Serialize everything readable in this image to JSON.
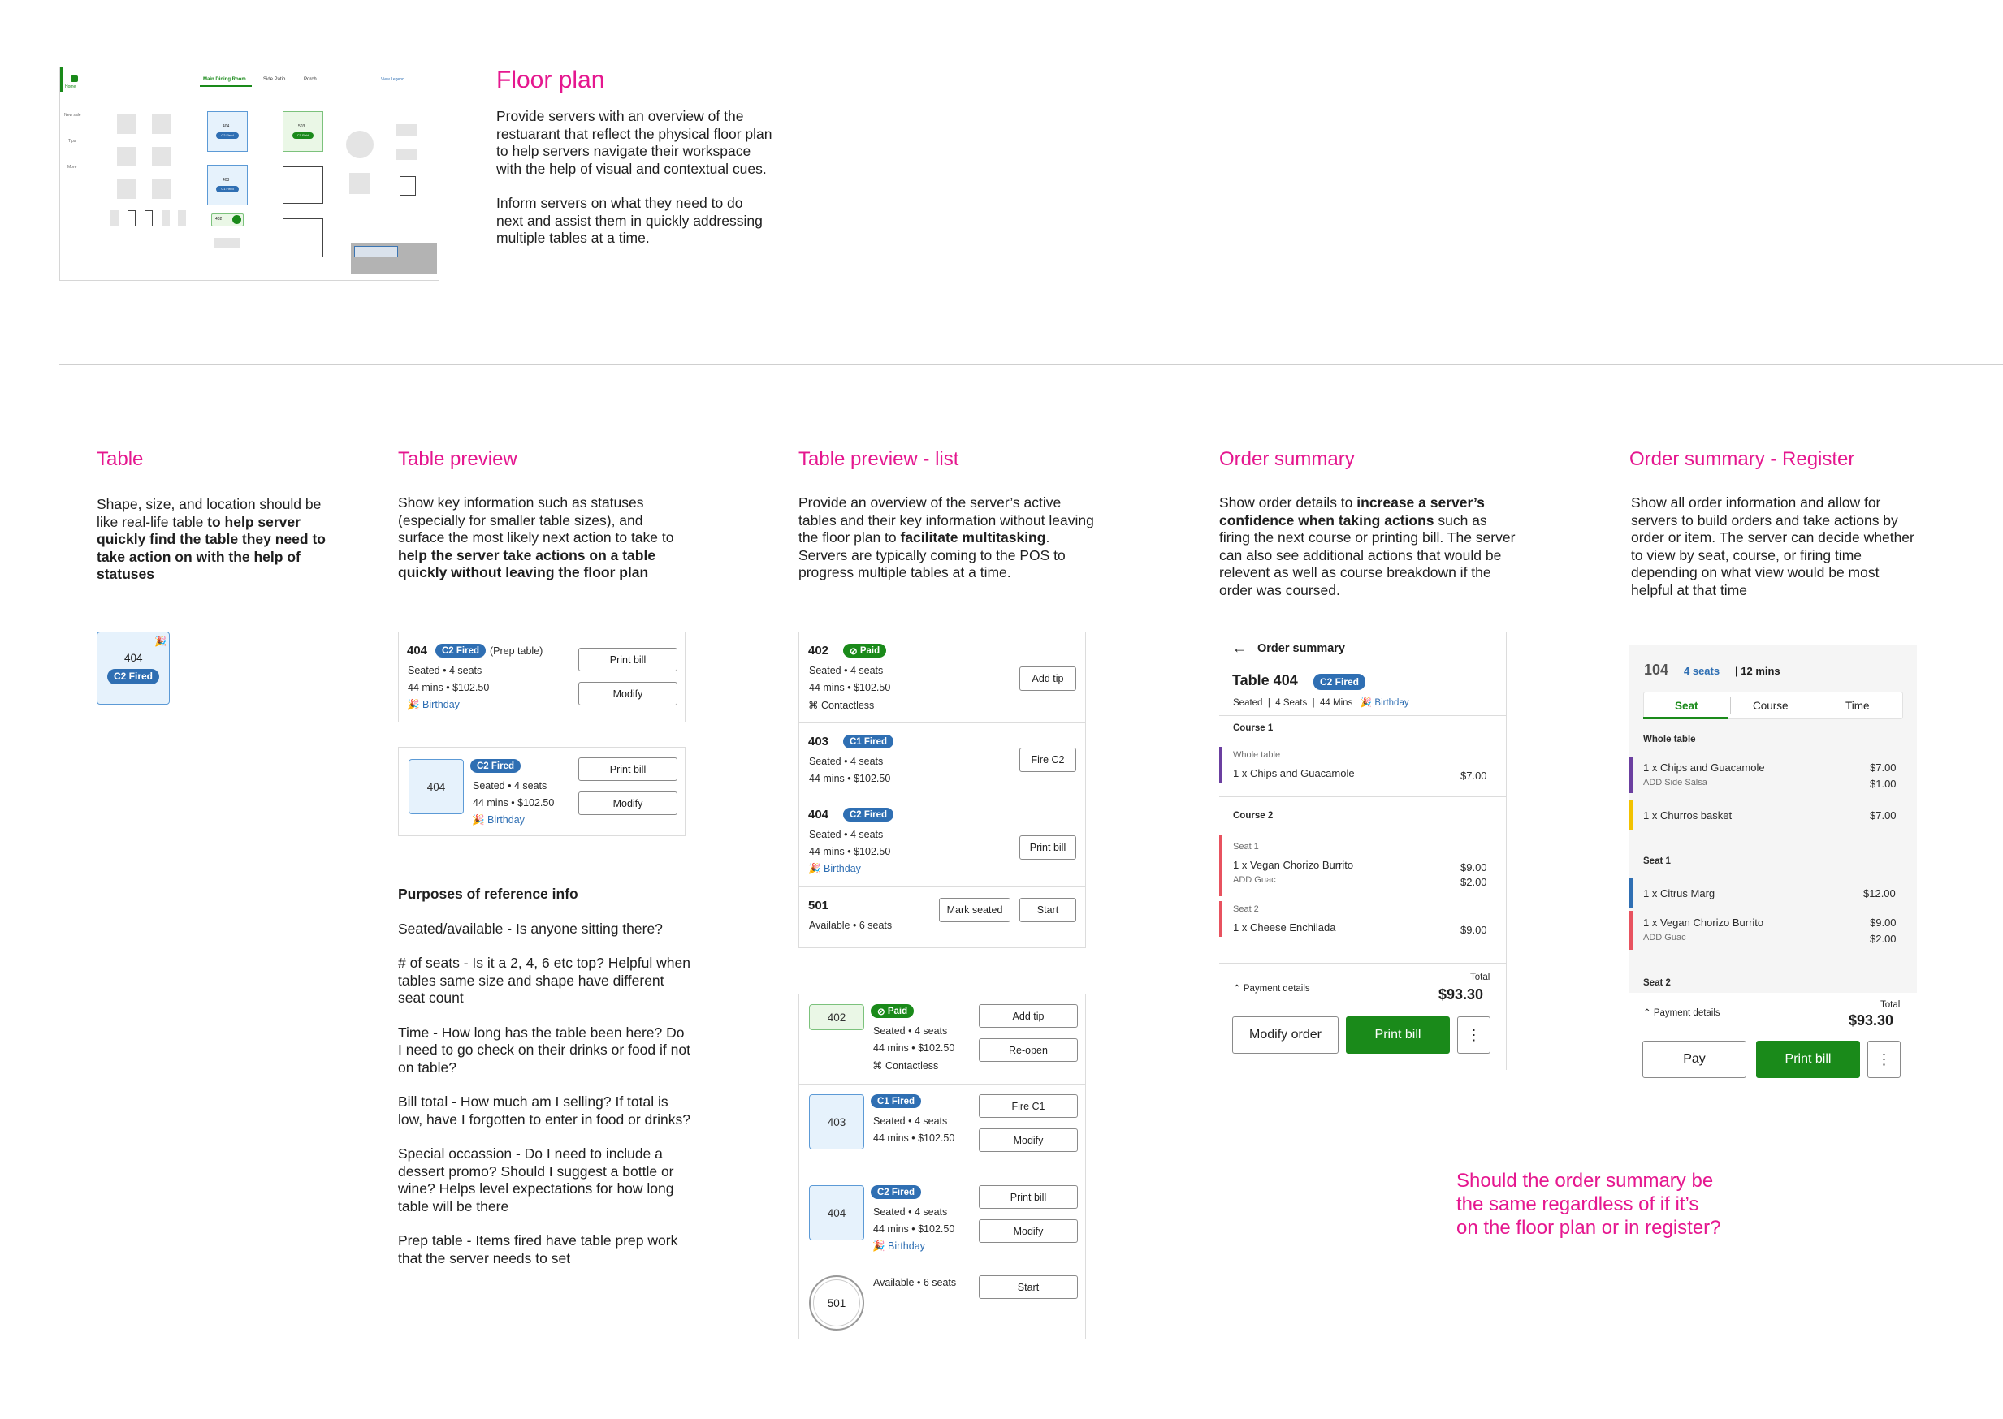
{
  "hero": {
    "title": "Floor plan",
    "p1": "Provide servers with an overview of the restuarant that reflect the physical floor plan to help servers navigate their workspace with the help of visual and contextual cues.",
    "p2": "Inform servers on what they need to do next and assist them in quickly addressing multiple tables at a time."
  },
  "mini": {
    "tab1": "Main Dining Room",
    "tab2": "Side Patio",
    "tab3": "Porch",
    "legend": "View Legend",
    "nav": [
      "Home",
      "New sale",
      "Tips",
      "More"
    ],
    "t404": "404",
    "t404b": "C2 Fired",
    "t403": "403",
    "t403b": "C1 Fired",
    "t503": "503",
    "t503b": "C1 Paid",
    "t402": "402"
  },
  "col1": {
    "title": "Table",
    "intro": "Shape, size, and location should be like real-life table ",
    "intro_b": "to help server quickly find the table they need to take action on with the help of statuses",
    "table_num": "404",
    "badge": "C2 Fired"
  },
  "col2": {
    "title": "Table preview",
    "intro": "Show key information such as statuses (especially for smaller table sizes), and surface the most likely next action to take to ",
    "intro_b": "help the server take actions on a table quickly without leaving the floor plan",
    "c1": {
      "num": "404",
      "badge": "C2 Fired",
      "note": "(Prep table)",
      "l1": "Seated • 4 seats",
      "l2": "44 mins • $102.50",
      "l3": "Birthday",
      "b1": "Print bill",
      "b2": "Modify"
    },
    "c2": {
      "tile": "404",
      "badge": "C2 Fired",
      "l1": "Seated • 4 seats",
      "l2": "44 mins • $102.50",
      "l3": "Birthday",
      "b1": "Print bill",
      "b2": "Modify"
    },
    "ref_title": "Purposes of reference info",
    "ref": [
      "Seated/available - Is anyone sitting there?",
      "# of seats - Is it a 2, 4, 6 etc top? Helpful when tables same size and shape have different seat count",
      "Time - How long has the table been here? Do I need to go check on their drinks or food if not on table?",
      "Bill total - How much am I selling? If total is low, have I forgotten to enter in food or drinks?",
      "Special occassion - Do I need to include a dessert promo? Should I suggest a bottle or wine? Helps level expectations for how long table will be there",
      "Prep table - Items fired have table prep work that the server needs to set"
    ]
  },
  "col3": {
    "title": "Table preview - list",
    "intro1": "Provide an overview of the server’s active tables and their key information without leaving the floor plan to ",
    "intro_b": "facilitate multitasking",
    "intro2": ". Servers are typically coming to the POS to progress multiple tables at a time.",
    "a": [
      {
        "num": "402",
        "badge": "Paid",
        "l1": "Seated • 4 seats",
        "l2": "44 mins • $102.50",
        "l3": "Contactless",
        "b1": "Add tip"
      },
      {
        "num": "403",
        "badge": "C1 Fired",
        "l1": "Seated • 4 seats",
        "l2": "44 mins • $102.50",
        "b1": "Fire C2"
      },
      {
        "num": "404",
        "badge": "C2 Fired",
        "l1": "Seated • 4 seats",
        "l2": "44 mins • $102.50",
        "l3": "Birthday",
        "b1": "Print bill"
      },
      {
        "num": "501",
        "l1": "Available • 6 seats",
        "b0": "Mark seated",
        "b1": "Start"
      }
    ],
    "b": [
      {
        "tile": "402",
        "badge": "Paid",
        "l1": "Seated • 4 seats",
        "l2": "44 mins • $102.50",
        "l3": "Contactless",
        "b1": "Add tip",
        "b2": "Re-open"
      },
      {
        "tile": "403",
        "badge": "C1 Fired",
        "l1": "Seated • 4 seats",
        "l2": "44 mins • $102.50",
        "b1": "Fire C1",
        "b2": "Modify"
      },
      {
        "tile": "404",
        "badge": "C2 Fired",
        "l1": "Seated • 4 seats",
        "l2": "44 mins • $102.50",
        "l3": "Birthday",
        "b1": "Print bill",
        "b2": "Modify"
      },
      {
        "tile": "501",
        "l1": "Available • 6 seats",
        "b1": "Start"
      }
    ]
  },
  "col4": {
    "title": "Order summary",
    "i1": "Show order details to ",
    "ib": "increase a server’s confidence when taking actions",
    "i2": " such as firing the next course or printing bill. The server can also see additional actions that would be relevent as well as course breakdown if the order was coursed.",
    "header": "Order summary",
    "table": "Table 404",
    "badge": "C2 Fired",
    "meta1": "Seated",
    "meta2": "4 Seats",
    "meta3": "44 Mins",
    "meta4": "Birthday",
    "course1": "Course 1",
    "whole": "Whole table",
    "item1": "1 x Chips and Guacamole",
    "p1": "$7.00",
    "course2": "Course 2",
    "seat1": "Seat 1",
    "item2": "1 x Vegan Chorizo Burrito",
    "p2": "$9.00",
    "mod2": "ADD Guac",
    "pm2": "$2.00",
    "seat2": "Seat 2",
    "item3": "1 x Cheese Enchilada",
    "p3": "$9.00",
    "pay": "Payment details",
    "total_l": "Total",
    "total": "$93.30",
    "btn1": "Modify order",
    "btn2": "Print bill"
  },
  "col5": {
    "title": "Order summary - Register",
    "intro": "Show all order information and allow for servers to build orders and take actions by order or item. The server can decide whether to view by seat, course, or firing time depending on what view would be most helpful at that time",
    "table": "104",
    "seats": "4 seats",
    "time": "| 12 mins",
    "tabs": [
      "Seat",
      "Course",
      "Time"
    ],
    "whole": "Whole table",
    "i1": "1 x Chips and Guacamole",
    "p1": "$7.00",
    "m1": "ADD Side Salsa",
    "pm1": "$1.00",
    "i2": "1 x Churros basket",
    "p2": "$7.00",
    "seat1": "Seat 1",
    "i3": "1 x Citrus Marg",
    "p3": "$12.00",
    "i4": "1 x Vegan Chorizo Burrito",
    "p4": "$9.00",
    "m4": "ADD Guac",
    "pm4": "$2.00",
    "seat2": "Seat 2",
    "pay": "Payment details",
    "total_l": "Total",
    "total": "$93.30",
    "btn1": "Pay",
    "btn2": "Print bill"
  },
  "question": "Should the order summary be the same regardless of if it’s on the floor plan or in register?",
  "colors": {
    "pink": "#e5178f",
    "blue": "#2f6fb3",
    "green": "#1a8a1a",
    "purple": "#6b3fa0",
    "red": "#e8525f",
    "yellow": "#f2c200",
    "navy": "#2f6fb3"
  }
}
